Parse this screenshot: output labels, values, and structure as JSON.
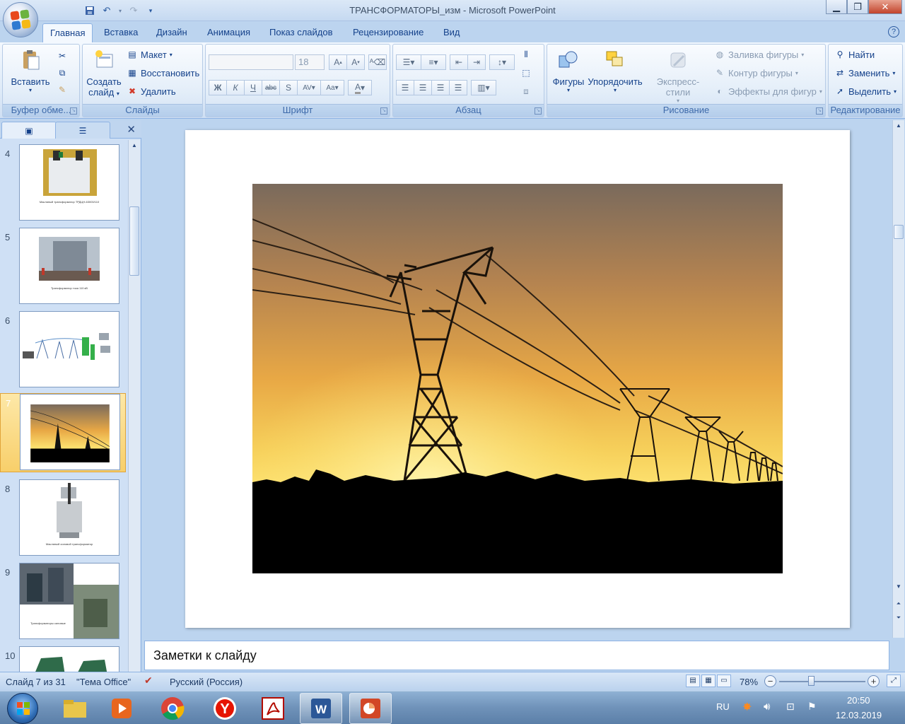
{
  "window": {
    "title": "ТРАНСФОРМАТОРЫ_изм - Microsoft PowerPoint",
    "controls": [
      "minimize",
      "maximize",
      "close"
    ]
  },
  "ribbon": {
    "tabs": [
      "Главная",
      "Вставка",
      "Дизайн",
      "Анимация",
      "Показ слайдов",
      "Рецензирование",
      "Вид"
    ],
    "active_tab": "Главная",
    "groups": {
      "clipboard": {
        "label": "Буфер обме...",
        "paste": "Вставить"
      },
      "slides": {
        "label": "Слайды",
        "new_slide_line1": "Создать",
        "new_slide_line2": "слайд",
        "layout": "Макет",
        "reset": "Восстановить",
        "delete": "Удалить"
      },
      "font": {
        "label": "Шрифт",
        "font_name": "",
        "font_size": "18"
      },
      "paragraph": {
        "label": "Абзац"
      },
      "drawing": {
        "label": "Рисование",
        "shapes": "Фигуры",
        "arrange": "Упорядочить",
        "quick_styles": "Экспресс-стили",
        "shape_fill": "Заливка фигуры",
        "shape_outline": "Контур фигуры",
        "shape_effects": "Эффекты для фигур"
      },
      "editing": {
        "label": "Редактирование",
        "find": "Найти",
        "replace": "Заменить",
        "select": "Выделить"
      }
    }
  },
  "slide_panel": {
    "thumbnails": [
      {
        "number": "4",
        "caption": "Масляный трансформатор ТРДЦН-63000/110"
      },
      {
        "number": "5",
        "caption": "Трансформатор тока 110 кВ"
      },
      {
        "number": "6",
        "caption": ""
      },
      {
        "number": "7",
        "caption": ""
      },
      {
        "number": "8",
        "caption": "Масляный силовой трансформатор"
      },
      {
        "number": "9",
        "caption": "Трансформаторы силовые"
      },
      {
        "number": "10",
        "caption": ""
      }
    ],
    "active_slide": "7"
  },
  "notes": {
    "placeholder": "Заметки к слайду"
  },
  "status": {
    "slide_info": "Слайд 7 из 31",
    "theme": "\"Тема Office\"",
    "language": "Русский (Россия)",
    "zoom": "78%",
    "zoom_level": 0.35
  },
  "taskbar": {
    "language": "RU",
    "time": "20:50",
    "date": "12.03.2019"
  },
  "colors": {
    "accent": "#15428b",
    "sky_top": "#7a6a5c",
    "sky_mid": "#e8a845",
    "sky_glow": "#fde270",
    "ground": "#000000",
    "selected_thumb": "#f8cf6a"
  }
}
